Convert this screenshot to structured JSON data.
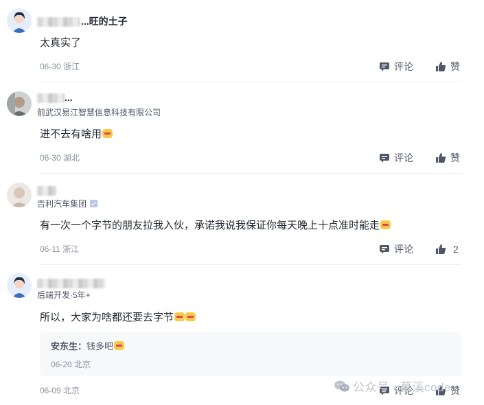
{
  "comments": [
    {
      "name_visible": "...旺的土子",
      "company": "",
      "text": "太真实了",
      "date": "06-30",
      "location": "浙江",
      "comment_label": "评论",
      "like_label": "赞"
    },
    {
      "name_visible": "...",
      "company": "前武汉易江智慧信息科技有限公司",
      "text": "进不去有啥用",
      "date": "06-30",
      "location": "湖北",
      "comment_label": "评论",
      "like_label": "赞"
    },
    {
      "name_visible": "",
      "company": "吉利汽车集团",
      "text": "有一次一个字节的朋友拉我入伙，承诺我说我保证你每天晚上十点准时能走",
      "date": "06-11",
      "location": "浙江",
      "comment_label": "评论",
      "like_label": "2"
    },
    {
      "name_visible": "",
      "company": "后端开发·5年+",
      "text": "所以，大家为啥都还要去字节",
      "date": "06-09",
      "location": "北京",
      "comment_label": "评论",
      "like_label": "赞",
      "reply": {
        "name": "安东生：",
        "text": "钱多吧",
        "date": "06-20",
        "location": "北京"
      }
    }
  ],
  "watermark": "公众号 · 慕溪code",
  "icons": {
    "comment": "comment-icon",
    "like": "thumbs-up-icon",
    "emoji": "emoji-icon",
    "verified": "verified-badge-icon",
    "wechat": "wechat-icon"
  },
  "colors": {
    "text": "#252933",
    "meta": "#8a919f",
    "divider": "#eceef2",
    "reply_bg": "#f7f8fa"
  }
}
